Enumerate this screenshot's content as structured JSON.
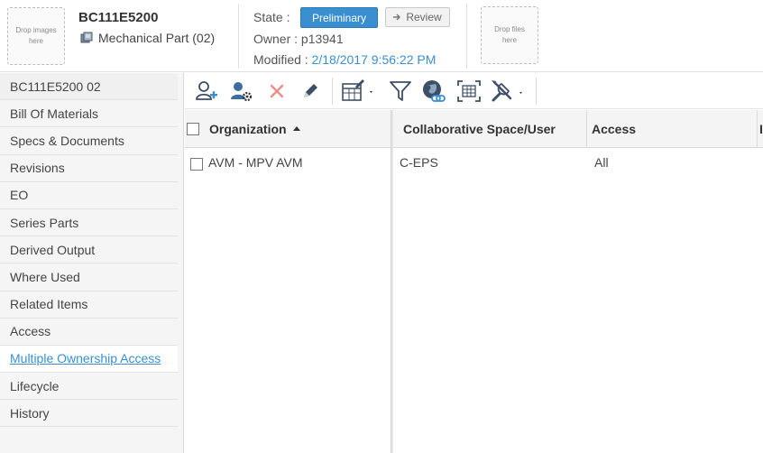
{
  "header": {
    "drop_images_text": "Drop images here",
    "title": "BC111E5200",
    "type_label": "Mechanical Part (02)",
    "state_label": "State :",
    "state_value": "Preliminary",
    "review_label": "Review",
    "owner_text": "Owner : p13941",
    "modified_label": "Modified :",
    "modified_value": "2/18/2017 9:56:22 PM",
    "drop_files_text": "Drop files here",
    "accent_color": "#3a8fd0"
  },
  "sidebar": {
    "items": [
      {
        "label": "BC111E5200 02"
      },
      {
        "label": "Bill Of Materials"
      },
      {
        "label": "Specs & Documents"
      },
      {
        "label": "Revisions"
      },
      {
        "label": "EO"
      },
      {
        "label": "Series Parts"
      },
      {
        "label": "Derived Output"
      },
      {
        "label": "Where Used"
      },
      {
        "label": "Related Items"
      },
      {
        "label": "Access"
      },
      {
        "label": "Multiple Ownership Access"
      },
      {
        "label": "Lifecycle"
      },
      {
        "label": "History"
      }
    ],
    "active": "Multiple Ownership Access"
  },
  "toolbar": {
    "icons": [
      "add-user-icon",
      "user-settings-icon",
      "delete-icon",
      "edit-icon",
      "table-edit-icon",
      "filter-icon",
      "globe-link-icon",
      "grid-select-icon",
      "tools-icon"
    ]
  },
  "table": {
    "columns": {
      "organization": "Organization",
      "space_user": "Collaborative Space/User",
      "access": "Access",
      "more": "I"
    },
    "rows": [
      {
        "organization": "AVM - MPV AVM",
        "space_user": "C-EPS",
        "access": "All"
      }
    ]
  }
}
